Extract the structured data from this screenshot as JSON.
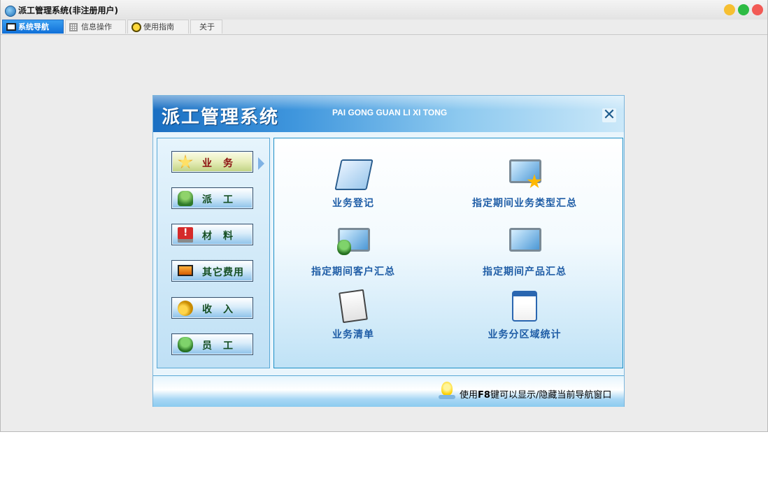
{
  "window": {
    "title": "派工管理系统(非注册用户)"
  },
  "tabs": [
    {
      "label": "系统导航",
      "icon": "monitor-icon",
      "active": true
    },
    {
      "label": "信息操作",
      "icon": "grid-icon",
      "active": false
    },
    {
      "label": "使用指南",
      "icon": "clock-icon",
      "active": false
    },
    {
      "label": "关于",
      "icon": "",
      "active": false
    }
  ],
  "nav_panel": {
    "title": "派工管理系统",
    "subtitle": "PAI GONG GUAN LI XI TONG",
    "close_label": "✕"
  },
  "categories": [
    {
      "label": "业务",
      "icon": "star-icon",
      "active": true
    },
    {
      "label": "派工",
      "icon": "worker-icon",
      "active": false
    },
    {
      "label": "材料",
      "icon": "alert-icon",
      "active": false
    },
    {
      "label": "其它费用",
      "icon": "monitor-icon",
      "active": false
    },
    {
      "label": "收入",
      "icon": "coins-icon",
      "active": false
    },
    {
      "label": "员工",
      "icon": "people-icon",
      "active": false
    }
  ],
  "functions": [
    {
      "label": "业务登记",
      "icon": "register-book-icon"
    },
    {
      "label": "指定期间业务类型汇总",
      "icon": "monitor-star-icon"
    },
    {
      "label": "指定期间客户汇总",
      "icon": "monitor-people-icon"
    },
    {
      "label": "指定期间产品汇总",
      "icon": "monitor-icon"
    },
    {
      "label": "业务清单",
      "icon": "notebook-icon"
    },
    {
      "label": "业务分区域统计",
      "icon": "calendar-icon"
    }
  ],
  "status": {
    "text_prefix": "使用",
    "key": "F8",
    "text_suffix": "键可以显示/隐藏当前导航窗口"
  },
  "colors": {
    "accent": "#1f6cc4",
    "function_label": "#1f5da6",
    "active_category_label": "#8a0d0d",
    "category_label": "#144e22"
  }
}
